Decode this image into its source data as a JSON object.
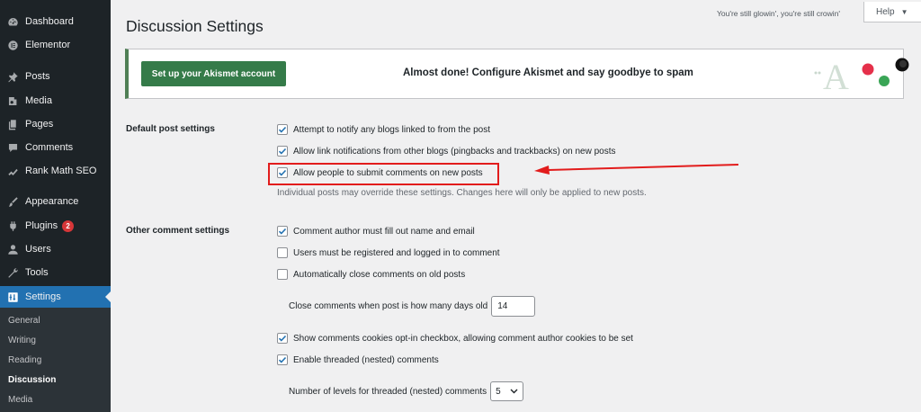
{
  "sidebar": {
    "items": [
      {
        "label": "Dashboard",
        "icon": "dashboard-icon"
      },
      {
        "label": "Elementor",
        "icon": "elementor-icon"
      },
      {
        "label": "Posts",
        "icon": "pin-icon"
      },
      {
        "label": "Media",
        "icon": "media-icon"
      },
      {
        "label": "Pages",
        "icon": "pages-icon"
      },
      {
        "label": "Comments",
        "icon": "comments-icon"
      },
      {
        "label": "Rank Math SEO",
        "icon": "rank-math-icon"
      },
      {
        "label": "Appearance",
        "icon": "brush-icon"
      },
      {
        "label": "Plugins",
        "icon": "plugin-icon",
        "badge": "2"
      },
      {
        "label": "Users",
        "icon": "users-icon"
      },
      {
        "label": "Tools",
        "icon": "wrench-icon"
      },
      {
        "label": "Settings",
        "icon": "settings-icon",
        "active": true
      }
    ],
    "submenu": [
      "General",
      "Writing",
      "Reading",
      "Discussion",
      "Media"
    ],
    "current_submenu": "Discussion"
  },
  "header": {
    "tagline": "You're still glowin', you're still crowin'",
    "help_label": "Help",
    "title": "Discussion Settings"
  },
  "akismet": {
    "button_label": "Set up your Akismet account",
    "message": "Almost done! Configure Akismet and say goodbye to spam",
    "logo_letter": "A"
  },
  "default_post_settings": {
    "label": "Default post settings",
    "options": [
      {
        "label": "Attempt to notify any blogs linked to from the post",
        "checked": true
      },
      {
        "label": "Allow link notifications from other blogs (pingbacks and trackbacks) on new posts",
        "checked": true
      },
      {
        "label": "Allow people to submit comments on new posts",
        "checked": true
      }
    ],
    "description": "Individual posts may override these settings. Changes here will only be applied to new posts."
  },
  "other_comment_settings": {
    "label": "Other comment settings",
    "options": [
      {
        "label": "Comment author must fill out name and email",
        "checked": true
      },
      {
        "label": "Users must be registered and logged in to comment",
        "checked": false
      },
      {
        "label": "Automatically close comments on old posts",
        "checked": false
      }
    ],
    "close_days_label": "Close comments when post is how many days old",
    "close_days_value": "14",
    "options_2": [
      {
        "label": "Show comments cookies opt-in checkbox, allowing comment author cookies to be set",
        "checked": true
      },
      {
        "label": "Enable threaded (nested) comments",
        "checked": true
      }
    ],
    "thread_levels_label": "Number of levels for threaded (nested) comments",
    "thread_levels_value": "5"
  },
  "colors": {
    "sidebar_bg": "#1d2327",
    "active_blue": "#2271b1",
    "akismet_green": "#357b49",
    "annotation_red": "#e21c1c"
  }
}
